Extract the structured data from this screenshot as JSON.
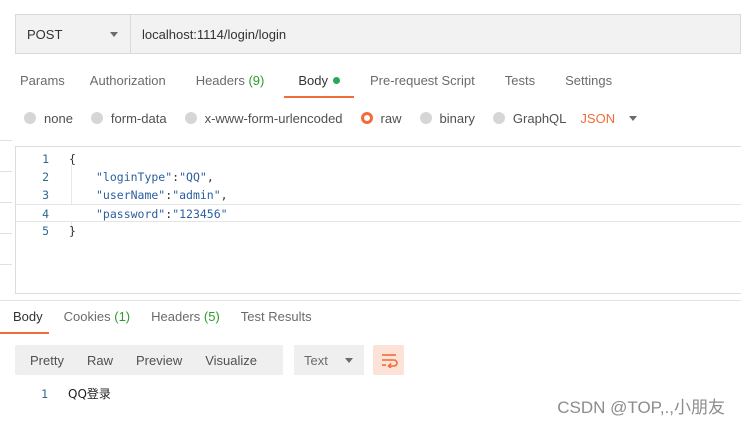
{
  "request": {
    "method": "POST",
    "url": "localhost:1114/login/login"
  },
  "tabs": [
    {
      "label": "Params"
    },
    {
      "label": "Authorization"
    },
    {
      "label": "Headers",
      "count": "(9)"
    },
    {
      "label": "Body"
    },
    {
      "label": "Pre-request Script"
    },
    {
      "label": "Tests"
    },
    {
      "label": "Settings"
    }
  ],
  "body_modes": [
    {
      "label": "none"
    },
    {
      "label": "form-data"
    },
    {
      "label": "x-www-form-urlencoded"
    },
    {
      "label": "raw"
    },
    {
      "label": "binary"
    },
    {
      "label": "GraphQL"
    }
  ],
  "format": "JSON",
  "editor": {
    "line_numbers": [
      "1",
      "2",
      "3",
      "4",
      "5"
    ],
    "open_brace": "{",
    "close_brace": "}",
    "fields": [
      {
        "key": "\"loginType\"",
        "value": "\"QQ\"",
        "trail": ","
      },
      {
        "key": "\"userName\"",
        "value": "\"admin\"",
        "trail": ","
      },
      {
        "key": "\"password\"",
        "value": "\"123456\"",
        "trail": ""
      }
    ]
  },
  "response": {
    "tabs": [
      {
        "label": "Body"
      },
      {
        "label": "Cookies",
        "count": "(1)"
      },
      {
        "label": "Headers",
        "count": "(5)"
      },
      {
        "label": "Test Results"
      }
    ],
    "views": [
      "Pretty",
      "Raw",
      "Preview",
      "Visualize"
    ],
    "type_select": "Text",
    "line_number": "1",
    "content": "QQ登录"
  },
  "watermark": "CSDN @TOP,.,小朋友",
  "colors": {
    "accent": "#f26b3a",
    "count_green": "#2a9d2a",
    "dot_green": "#2aa55a"
  }
}
